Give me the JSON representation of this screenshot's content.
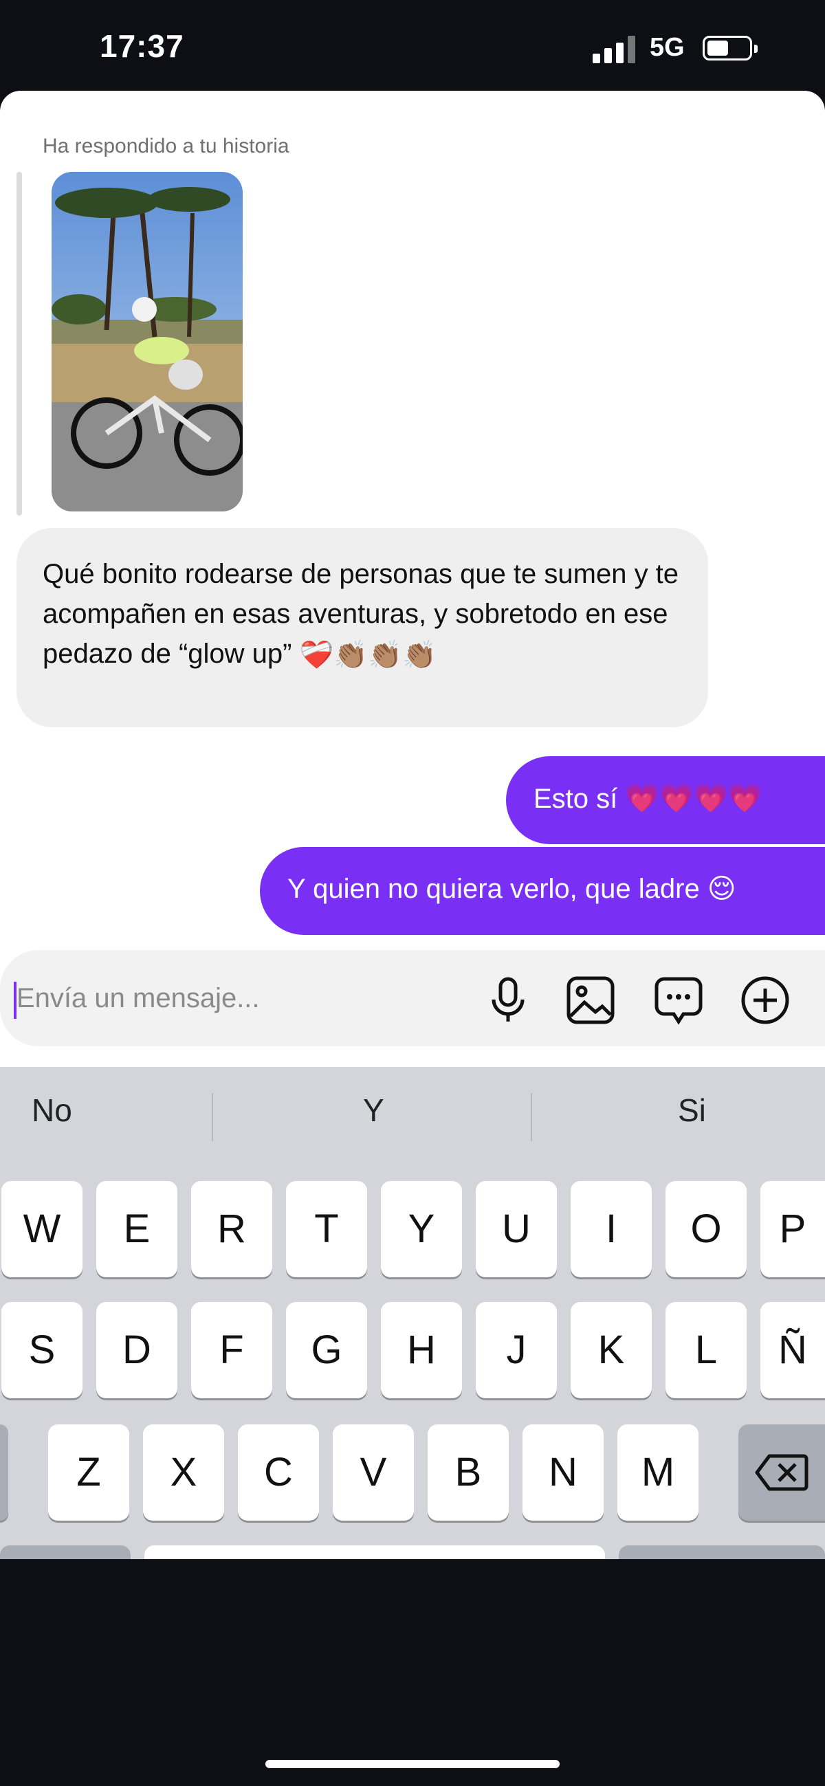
{
  "status_bar": {
    "time": "17:37",
    "network": "5G"
  },
  "chat": {
    "story_reply_label": "Ha respondido a tu historia",
    "incoming_message": "Qué bonito rodearse de personas que te sumen y te acompañen en esas aventuras, y sobretodo en ese pedazo de “glow up”",
    "incoming_emojis": "❤️‍🩹👏🏽👏🏽👏🏽",
    "outgoing": [
      {
        "text": "Esto sí",
        "emojis": "💗💗💗💗"
      },
      {
        "text": "Y quien no quiera verlo, que ladre",
        "emojis": "😌"
      }
    ]
  },
  "composer": {
    "placeholder": "Envía un mensaje..."
  },
  "keyboard": {
    "suggestions": [
      "No",
      "Y",
      "Si"
    ],
    "row1": [
      "W",
      "E",
      "R",
      "T",
      "Y",
      "U",
      "I",
      "O",
      "P"
    ],
    "row2": [
      "S",
      "D",
      "F",
      "G",
      "H",
      "J",
      "K",
      "L",
      "Ñ"
    ],
    "row3": [
      "Z",
      "X",
      "C",
      "V",
      "B",
      "N",
      "M"
    ]
  },
  "colors": {
    "accent": "#7a2ff5",
    "incoming_bubble": "#efefef",
    "background": "#0e0f14",
    "keyboard": "#d3d5db"
  }
}
